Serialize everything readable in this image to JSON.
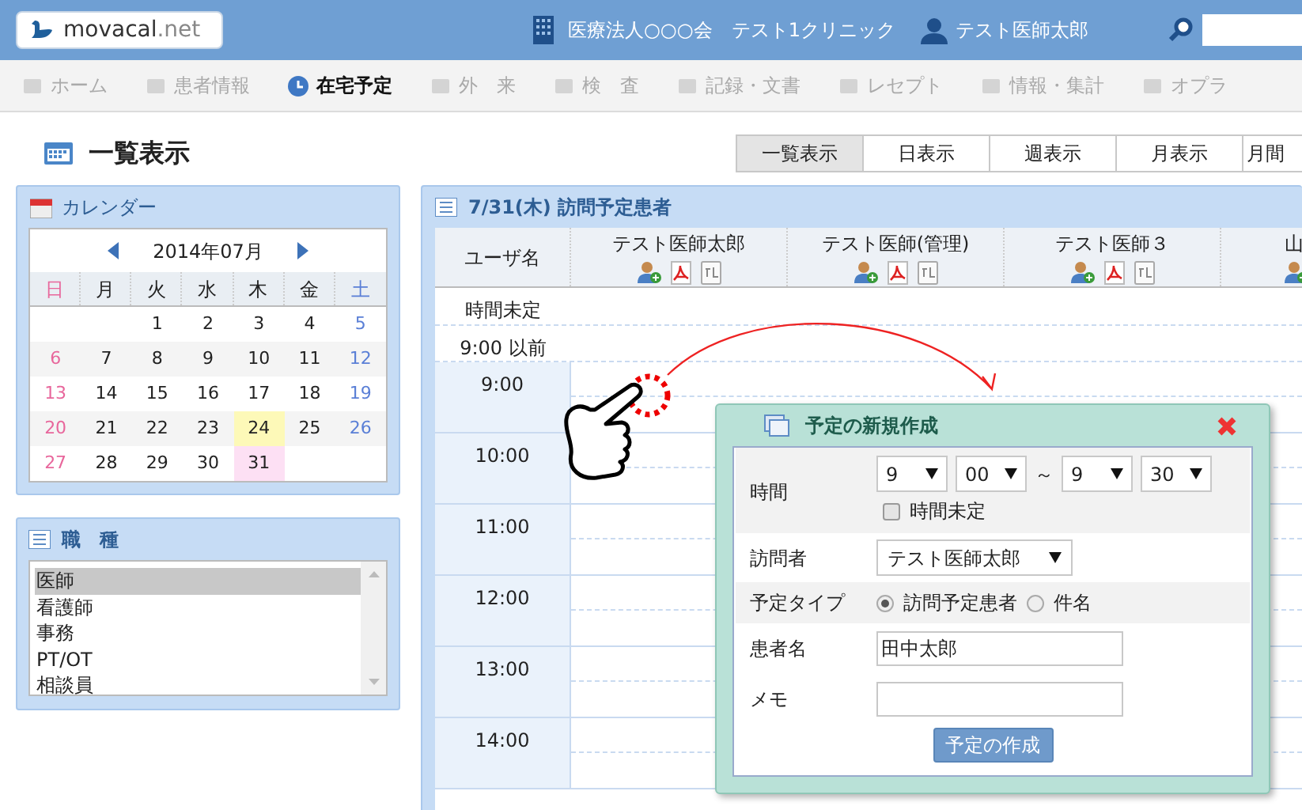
{
  "header": {
    "logo_name": "movacal",
    "logo_suffix": ".net",
    "organization": "医療法人○○○会　テスト1クリニック",
    "user": "テスト医師太郎"
  },
  "nav": [
    {
      "label": "ホーム",
      "selected": false
    },
    {
      "label": "患者情報",
      "selected": false
    },
    {
      "label": "在宅予定",
      "selected": true
    },
    {
      "label": "外　来",
      "selected": false
    },
    {
      "label": "検　査",
      "selected": false
    },
    {
      "label": "記録・文書",
      "selected": false
    },
    {
      "label": "レセプト",
      "selected": false
    },
    {
      "label": "情報・集計",
      "selected": false
    },
    {
      "label": "オプラ",
      "selected": false
    }
  ],
  "page_title": "一覧表示",
  "view_tabs": [
    {
      "label": "一覧表示",
      "selected": true
    },
    {
      "label": "日表示",
      "selected": false
    },
    {
      "label": "週表示",
      "selected": false
    },
    {
      "label": "月表示",
      "selected": false
    },
    {
      "label": "月間",
      "selected": false
    }
  ],
  "calendar": {
    "title": "カレンダー",
    "month": "2014年07月",
    "weekdays": [
      "日",
      "月",
      "火",
      "水",
      "木",
      "金",
      "土"
    ],
    "weeks": [
      [
        {
          "day": "1"
        },
        {
          "day": "2"
        },
        {
          "day": "3"
        },
        {
          "day": "4"
        },
        {
          "day": "5"
        }
      ],
      [
        {
          "day": "6"
        },
        {
          "day": "7"
        },
        {
          "day": "8"
        },
        {
          "day": "9"
        },
        {
          "day": "10"
        },
        {
          "day": "11"
        },
        {
          "day": "12"
        }
      ],
      [
        {
          "day": "13"
        },
        {
          "day": "14"
        },
        {
          "day": "15"
        },
        {
          "day": "16"
        },
        {
          "day": "17"
        },
        {
          "day": "18"
        },
        {
          "day": "19"
        }
      ],
      [
        {
          "day": "20"
        },
        {
          "day": "21"
        },
        {
          "day": "22"
        },
        {
          "day": "23"
        },
        {
          "day": "24",
          "today": true
        },
        {
          "day": "25"
        },
        {
          "day": "26"
        }
      ],
      [
        {
          "day": "27"
        },
        {
          "day": "28"
        },
        {
          "day": "29"
        },
        {
          "day": "30"
        },
        {
          "day": "31",
          "selected": true
        }
      ]
    ]
  },
  "job_types": {
    "title": "職　種",
    "items": [
      {
        "label": "医師",
        "selected": true
      },
      {
        "label": "看護師",
        "selected": false
      },
      {
        "label": "事務",
        "selected": false
      },
      {
        "label": "PT/OT",
        "selected": false
      },
      {
        "label": "相談員",
        "selected": false
      }
    ]
  },
  "schedule": {
    "title": "7/31(木) 訪問予定患者",
    "user_column": "ユーザ名",
    "staff": [
      {
        "name": "テスト医師太郎"
      },
      {
        "name": "テスト医師(管理)"
      },
      {
        "name": "テスト医師３"
      },
      {
        "name": "山"
      }
    ],
    "rows": [
      "時間未定",
      "9:00 以前",
      "9:00",
      "10:00",
      "11:00",
      "12:00",
      "13:00",
      "14:00"
    ]
  },
  "dialog": {
    "title": "予定の新規作成",
    "time_label": "時間",
    "start_hour": "9",
    "start_minute": "00",
    "separator": "～",
    "end_hour": "9",
    "end_minute": "30",
    "undecided": {
      "label": "時間未定",
      "checked": false
    },
    "visitor_label": "訪問者",
    "visitor": "テスト医師太郎",
    "type_label": "予定タイプ",
    "types": [
      {
        "label": "訪問予定患者",
        "selected": true
      },
      {
        "label": "件名",
        "selected": false
      }
    ],
    "patient_label": "患者名",
    "patient": "田中太郎",
    "memo_label": "メモ",
    "submit": "予定の作成"
  }
}
